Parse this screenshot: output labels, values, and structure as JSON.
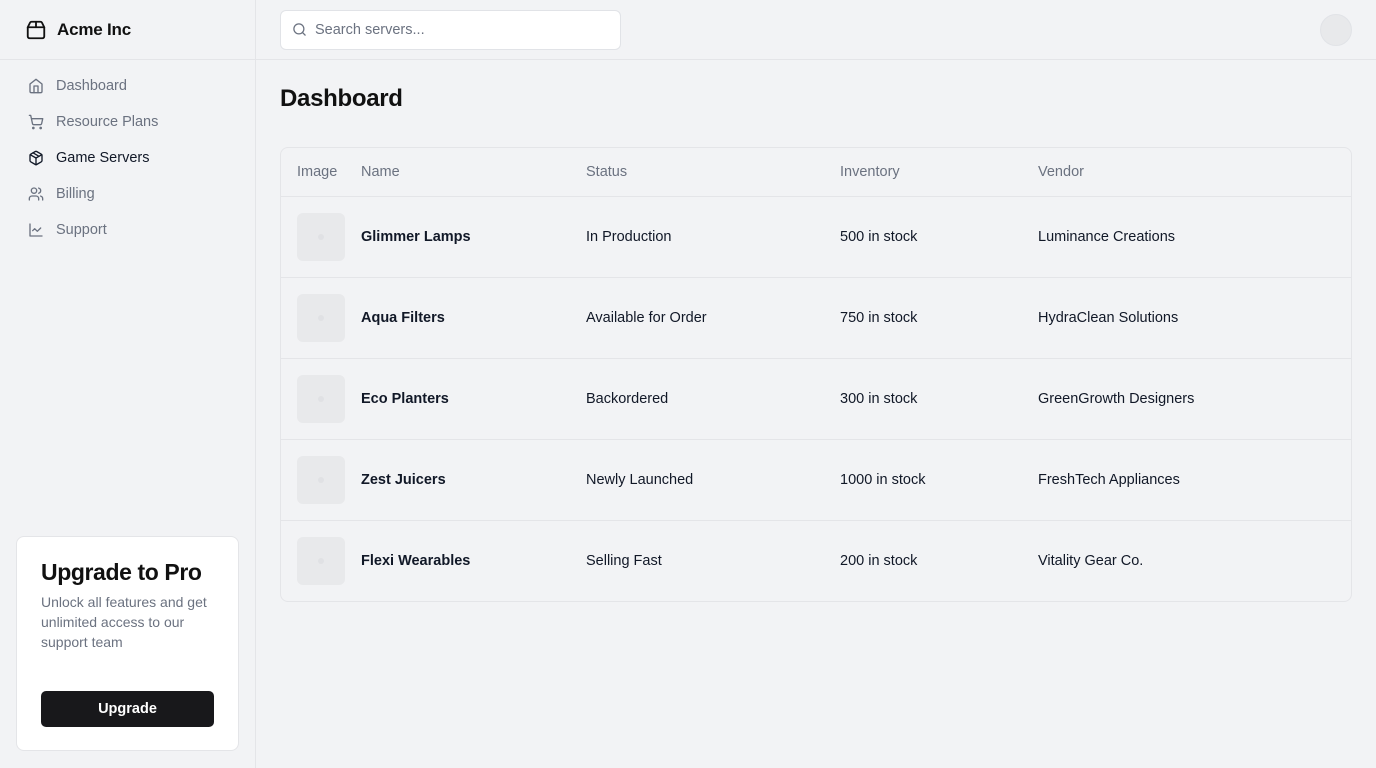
{
  "brand": {
    "name": "Acme Inc",
    "icon": "package-icon"
  },
  "nav": {
    "items": [
      {
        "label": "Dashboard",
        "icon": "home-icon",
        "active": false
      },
      {
        "label": "Resource Plans",
        "icon": "cart-icon",
        "active": false
      },
      {
        "label": "Game Servers",
        "icon": "box-icon",
        "active": true
      },
      {
        "label": "Billing",
        "icon": "users-icon",
        "active": false
      },
      {
        "label": "Support",
        "icon": "line-chart-icon",
        "active": false
      }
    ]
  },
  "upgrade": {
    "title": "Upgrade to Pro",
    "description": "Unlock all features and get unlimited access to our support team",
    "button_label": "Upgrade"
  },
  "search": {
    "placeholder": "Search servers..."
  },
  "page": {
    "title": "Dashboard"
  },
  "table": {
    "headers": {
      "image": "Image",
      "name": "Name",
      "status": "Status",
      "inventory": "Inventory",
      "vendor": "Vendor"
    },
    "rows": [
      {
        "name": "Glimmer Lamps",
        "status": "In Production",
        "inventory": "500 in stock",
        "vendor": "Luminance Creations"
      },
      {
        "name": "Aqua Filters",
        "status": "Available for Order",
        "inventory": "750 in stock",
        "vendor": "HydraClean Solutions"
      },
      {
        "name": "Eco Planters",
        "status": "Backordered",
        "inventory": "300 in stock",
        "vendor": "GreenGrowth Designers"
      },
      {
        "name": "Zest Juicers",
        "status": "Newly Launched",
        "inventory": "1000 in stock",
        "vendor": "FreshTech Appliances"
      },
      {
        "name": "Flexi Wearables",
        "status": "Selling Fast",
        "inventory": "200 in stock",
        "vendor": "Vitality Gear Co."
      }
    ]
  },
  "colors": {
    "background": "#f2f3f5",
    "primary_button": "#18181b",
    "muted_text": "#6b7280",
    "border": "#e4e5e8"
  }
}
